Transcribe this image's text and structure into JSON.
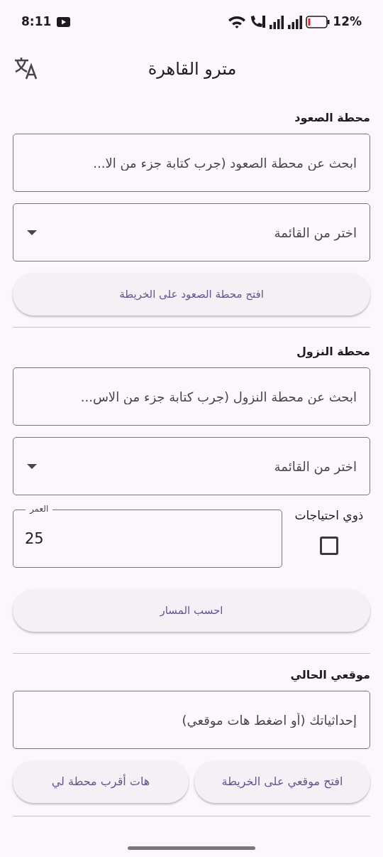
{
  "status_bar": {
    "time": "8:11",
    "battery": "12%"
  },
  "app_bar": {
    "title": "مترو القاهرة"
  },
  "boarding": {
    "heading": "محطة الصعود",
    "search": {
      "placeholder": "ابحث عن محطة الصعود (جرب كتابة جزء من الا..."
    },
    "dropdown": {
      "placeholder": "اختر من القائمة"
    },
    "map_button": "افتح محطة الصعود على الخريطة"
  },
  "alighting": {
    "heading": "محطة النزول",
    "search": {
      "placeholder": "ابحث عن محطة النزول (جرب كتابة جزء من الاس..."
    },
    "dropdown": {
      "placeholder": "اختر من القائمة"
    }
  },
  "special_needs": {
    "label": "ذوي احتياجات",
    "checked": false
  },
  "age": {
    "label": "العمر",
    "value": "25"
  },
  "calculate_button": "احسب المسار",
  "location": {
    "heading": "موقعي الحالي",
    "input": {
      "placeholder": "إحداثياتك (أو اضغط هات موقعي)"
    },
    "buttons": [
      "افتح موقعي على الخريطة",
      "هات أقرب محطة لي"
    ]
  }
}
